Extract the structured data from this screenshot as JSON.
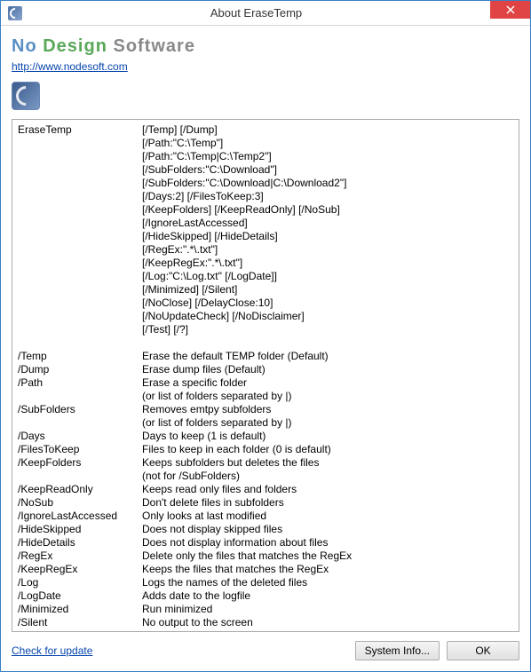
{
  "title": "About EraseTemp",
  "logo": {
    "word1": "No",
    "word2": "Design",
    "word3": "Software"
  },
  "url": "http://www.nodesoft.com",
  "header": {
    "col1": "EraseTemp"
  },
  "optsLines": [
    "[/Temp] [/Dump]",
    "[/Path:\"C:\\Temp\"]",
    "[/Path:\"C:\\Temp|C:\\Temp2\"]",
    "[/SubFolders:\"C:\\Download\"]",
    "[/SubFolders:\"C:\\Download|C:\\Download2\"]",
    "[/Days:2] [/FilesToKeep:3]",
    "[/KeepFolders] [/KeepReadOnly] [/NoSub]",
    "[/IgnoreLastAccessed]",
    "[/HideSkipped] [/HideDetails]",
    "[/RegEx:\".*\\.txt\"]",
    "[/KeepRegEx:\".*\\.txt\"]",
    "[/Log:\"C:\\Log.txt\" [/LogDate]]",
    "[/Minimized] [/Silent]",
    "[/NoClose] [/DelayClose:10]",
    "[/NoUpdateCheck] [/NoDisclaimer]",
    "[/Test] [/?]"
  ],
  "switches": [
    {
      "k": "/Temp",
      "d": "Erase the default TEMP folder (Default)"
    },
    {
      "k": "/Dump",
      "d": "Erase dump files (Default)"
    },
    {
      "k": "/Path",
      "d": "Erase a specific folder"
    },
    {
      "k": "",
      "d": "(or list of folders separated by |)"
    },
    {
      "k": "/SubFolders",
      "d": "Removes emtpy subfolders"
    },
    {
      "k": "",
      "d": "(or list of folders separated by |)"
    },
    {
      "k": "/Days",
      "d": "Days to keep (1 is default)"
    },
    {
      "k": "/FilesToKeep",
      "d": "Files to keep in each folder (0 is default)"
    },
    {
      "k": "/KeepFolders",
      "d": "Keeps subfolders but deletes the files"
    },
    {
      "k": "",
      "d": "(not for /SubFolders)"
    },
    {
      "k": "/KeepReadOnly",
      "d": "Keeps read only files and folders"
    },
    {
      "k": "/NoSub",
      "d": "Don't delete files in subfolders"
    },
    {
      "k": "/IgnoreLastAccessed",
      "d": "Only looks at last modified"
    },
    {
      "k": "/HideSkipped",
      "d": "Does not display skipped files"
    },
    {
      "k": "/HideDetails",
      "d": "Does not display information about files"
    },
    {
      "k": "/RegEx",
      "d": "Delete only the files that matches the RegEx"
    },
    {
      "k": "/KeepRegEx",
      "d": "Keeps the files that matches the RegEx"
    },
    {
      "k": "/Log",
      "d": "Logs the names of the deleted files"
    },
    {
      "k": "/LogDate",
      "d": "Adds date to the logfile"
    },
    {
      "k": "/Minimized",
      "d": "Run minimized"
    },
    {
      "k": "/Silent",
      "d": "No output to the screen"
    }
  ],
  "footer": {
    "update": "Check for update",
    "sysinfo": "System Info...",
    "ok": "OK"
  }
}
